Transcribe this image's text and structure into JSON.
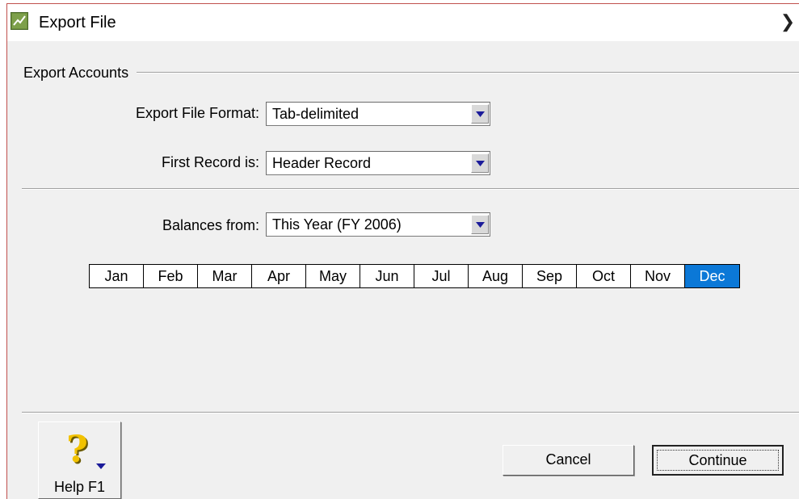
{
  "window": {
    "title": "Export File",
    "close_glyph": "❯",
    "app_icon": "chart-icon"
  },
  "export_accounts": {
    "section_label": "Export Accounts",
    "file_format": {
      "label": "Export File Format:",
      "value": "Tab-delimited"
    },
    "first_record": {
      "label": "First Record is:",
      "value": "Header Record"
    },
    "balances_from": {
      "label": "Balances from:",
      "value": "This Year (FY 2006)"
    }
  },
  "months": [
    {
      "label": "Jan"
    },
    {
      "label": "Feb"
    },
    {
      "label": "Mar"
    },
    {
      "label": "Apr"
    },
    {
      "label": "May"
    },
    {
      "label": "Jun"
    },
    {
      "label": "Jul"
    },
    {
      "label": "Aug"
    },
    {
      "label": "Sep"
    },
    {
      "label": "Oct"
    },
    {
      "label": "Nov"
    },
    {
      "label": "Dec"
    }
  ],
  "selected_month": "Dec",
  "buttons": {
    "help": "Help F1",
    "help_icon": "help-question-icon",
    "cancel": "Cancel",
    "continue": "Continue"
  },
  "colors": {
    "selection": "#0b78d7",
    "dropdown_arrow": "#1b1b9a",
    "help_icon": "#f2c200"
  }
}
